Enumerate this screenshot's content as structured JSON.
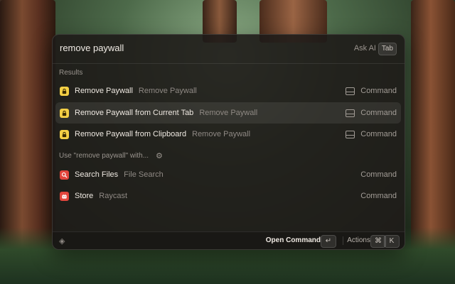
{
  "search": {
    "value": "remove paywall",
    "ask_ai": "Ask AI",
    "tab_key": "Tab"
  },
  "sections": {
    "results": "Results",
    "use_with": "Use \"remove paywall\" with..."
  },
  "results": [
    {
      "title": "Remove Paywall",
      "subtitle": "Remove Paywall",
      "type": "Command",
      "icon": "lock-icon"
    },
    {
      "title": "Remove Paywall from Current Tab",
      "subtitle": "Remove Paywall",
      "type": "Command",
      "icon": "lock-icon"
    },
    {
      "title": "Remove Paywall from Clipboard",
      "subtitle": "Remove Paywall",
      "type": "Command",
      "icon": "lock-icon"
    }
  ],
  "fallbacks": [
    {
      "title": "Search Files",
      "subtitle": "File Search",
      "type": "Command",
      "icon": "magnifier-icon"
    },
    {
      "title": "Store",
      "subtitle": "Raycast",
      "type": "Command",
      "icon": "store-icon"
    }
  ],
  "footer": {
    "primary_action": "Open Command",
    "enter_key": "↵",
    "actions_label": "Actions",
    "cmd_key": "⌘",
    "k_key": "K"
  },
  "colors": {
    "accent_yellow": "#f4cf45",
    "accent_red": "#e2453c",
    "panel_bg": "#1e1b18"
  }
}
